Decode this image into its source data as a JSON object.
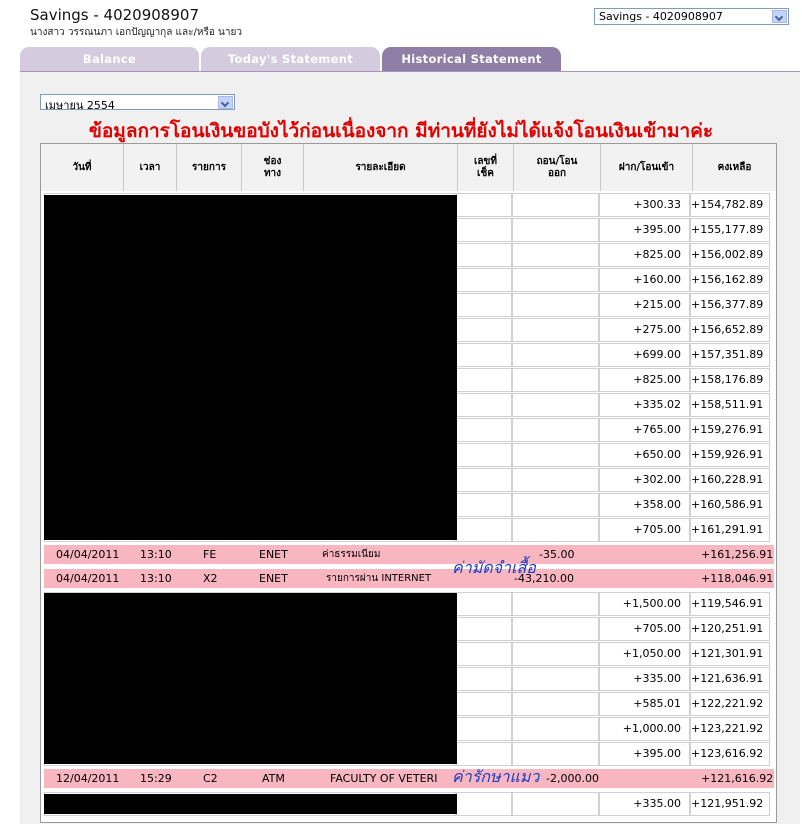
{
  "header": {
    "title": "Savings - 4020908907",
    "owner": "นางสาว วรรณนภา เอกปัญญากุล และ/หรือ นายว",
    "account_select": "Savings - 4020908907"
  },
  "tabs": [
    {
      "label": "Balance",
      "active": false
    },
    {
      "label": "Today's Statement",
      "active": false
    },
    {
      "label": "Historical Statement",
      "active": true
    }
  ],
  "month_select": "เมษายน 2554",
  "notice": "ข้อมูลการโอนเงินขอบังไว้ก่อนเนื่องจาก มีท่านที่ยังไม่ได้แจ้งโอนเงินเข้ามาค่ะ",
  "table": {
    "columns": [
      "วันที่",
      "เวลา",
      "รายการ",
      "ช่องทาง",
      "รายละเอียด",
      "เลขที่เช็ค",
      "ถอน/โอนออก",
      "ฝาก/โอนเข้า",
      "คงเหลือ"
    ],
    "rows_block1": [
      {
        "deposit": "+300.33",
        "balance": "+154,782.89"
      },
      {
        "deposit": "+395.00",
        "balance": "+155,177.89"
      },
      {
        "deposit": "+825.00",
        "balance": "+156,002.89"
      },
      {
        "deposit": "+160.00",
        "balance": "+156,162.89"
      },
      {
        "deposit": "+215.00",
        "balance": "+156,377.89"
      },
      {
        "deposit": "+275.00",
        "balance": "+156,652.89"
      },
      {
        "deposit": "+699.00",
        "balance": "+157,351.89"
      },
      {
        "deposit": "+825.00",
        "balance": "+158,176.89"
      },
      {
        "deposit": "+335.02",
        "balance": "+158,511.91"
      },
      {
        "deposit": "+765.00",
        "balance": "+159,276.91"
      },
      {
        "deposit": "+650.00",
        "balance": "+159,926.91"
      },
      {
        "deposit": "+302.00",
        "balance": "+160,228.91"
      },
      {
        "deposit": "+358.00",
        "balance": "+160,586.91"
      },
      {
        "deposit": "+705.00",
        "balance": "+161,291.91"
      }
    ],
    "highlight1": [
      {
        "date": "04/04/2011",
        "time": "13:10",
        "code": "FE",
        "channel": "ENET",
        "detail": "ค่าธรรมเนียม",
        "withdraw": "-35.00",
        "balance": "+161,256.91"
      },
      {
        "date": "04/04/2011",
        "time": "13:10",
        "code": "X2",
        "channel": "ENET",
        "detail": "รายการผ่าน INTERNET",
        "withdraw": "-43,210.00",
        "balance": "+118,046.91"
      }
    ],
    "annotation1": "ค่ามัดจำเสื้อ",
    "rows_block2": [
      {
        "deposit": "+1,500.00",
        "balance": "+119,546.91"
      },
      {
        "deposit": "+705.00",
        "balance": "+120,251.91"
      },
      {
        "deposit": "+1,050.00",
        "balance": "+121,301.91"
      },
      {
        "deposit": "+335.00",
        "balance": "+121,636.91"
      },
      {
        "deposit": "+585.01",
        "balance": "+122,221.92"
      },
      {
        "deposit": "+1,000.00",
        "balance": "+123,221.92"
      },
      {
        "deposit": "+395.00",
        "balance": "+123,616.92"
      }
    ],
    "highlight2": {
      "date": "12/04/2011",
      "time": "15:29",
      "code": "C2",
      "channel": "ATM",
      "detail": "FACULTY OF VETERI",
      "withdraw": "-2,000.00",
      "balance": "+121,616.92"
    },
    "annotation2": "ค่ารักษาแมว",
    "rows_block3": [
      {
        "deposit": "+335.00",
        "balance": "+121,951.92"
      }
    ]
  }
}
